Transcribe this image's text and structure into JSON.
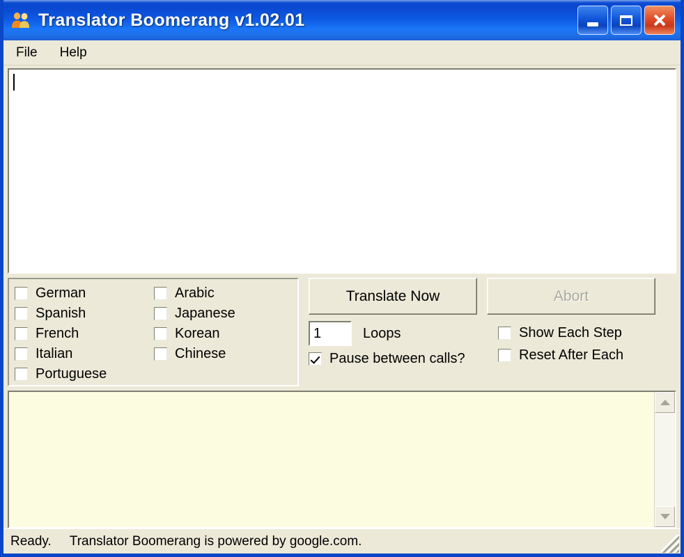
{
  "window": {
    "title": "Translator Boomerang v1.02.01",
    "icon": "people-icon",
    "controls": {
      "minimize_label": "Minimize",
      "maximize_label": "Maximize",
      "close_label": "Close"
    },
    "colors": {
      "titlebar_dark": "#0a46c8",
      "titlebar_light": "#1b76f7",
      "close_button": "#e2502a",
      "face": "#ece9d8",
      "output_background": "#fcfce0"
    }
  },
  "menu": {
    "items": [
      {
        "label": "File"
      },
      {
        "label": "Help"
      }
    ]
  },
  "input_area": {
    "value": "",
    "caret_visible": true
  },
  "languages": {
    "column1": [
      {
        "label": "German",
        "checked": false
      },
      {
        "label": "Spanish",
        "checked": false
      },
      {
        "label": "French",
        "checked": false
      },
      {
        "label": "Italian",
        "checked": false
      },
      {
        "label": "Portuguese",
        "checked": false
      }
    ],
    "column2": [
      {
        "label": "Arabic",
        "checked": false
      },
      {
        "label": "Japanese",
        "checked": false
      },
      {
        "label": "Korean",
        "checked": false
      },
      {
        "label": "Chinese",
        "checked": false
      }
    ]
  },
  "actions": {
    "translate_label": "Translate Now",
    "translate_enabled": true,
    "abort_label": "Abort",
    "abort_enabled": false
  },
  "options": {
    "loops_value": "1",
    "loops_label": "Loops",
    "pause_label": "Pause between calls?",
    "pause_checked": true,
    "show_each_step_label": "Show Each Step",
    "show_each_step_checked": false,
    "reset_after_each_label": "Reset After Each",
    "reset_after_each_checked": false
  },
  "output": {
    "text": "",
    "scroll_up_icon": "chevron-up-icon",
    "scroll_down_icon": "chevron-down-icon"
  },
  "status": {
    "ready": "Ready.",
    "message": "Translator Boomerang is powered by google.com."
  }
}
